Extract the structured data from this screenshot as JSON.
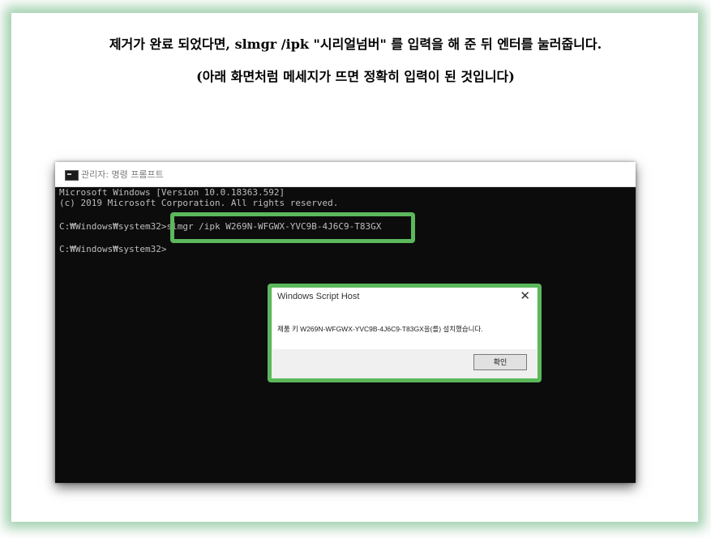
{
  "instructions": {
    "line1": "제거가 완료 되었다면, slmgr /ipk \"시리얼넘버\" 를 입력을 해 준 뒤 엔터를 눌러줍니다.",
    "line2": "(아래 화면처럼 메세지가 뜨면 정확히 입력이 된 것입니다)"
  },
  "window": {
    "title": "관리자: 명령 프롬프트"
  },
  "console": {
    "lines": [
      "Microsoft Windows [Version 10.0.18363.592]",
      "(c) 2019 Microsoft Corporation. All rights reserved.",
      "C:₩Windows₩system32>slmgr /ipk W269N-WFGWX-YVC9B-4J6C9-T83GX",
      "C:₩Windows₩system32>"
    ]
  },
  "dialog": {
    "title": "Windows Script Host",
    "close": "✕",
    "message": "제품 키 W269N-WFGWX-YVC9B-4J6C9-T83GX을(를) 설치했습니다.",
    "ok_label": "확인"
  },
  "colors": {
    "highlight": "#5cb85c",
    "glow": "#56aa6e",
    "console_bg": "#0c0c0c"
  }
}
